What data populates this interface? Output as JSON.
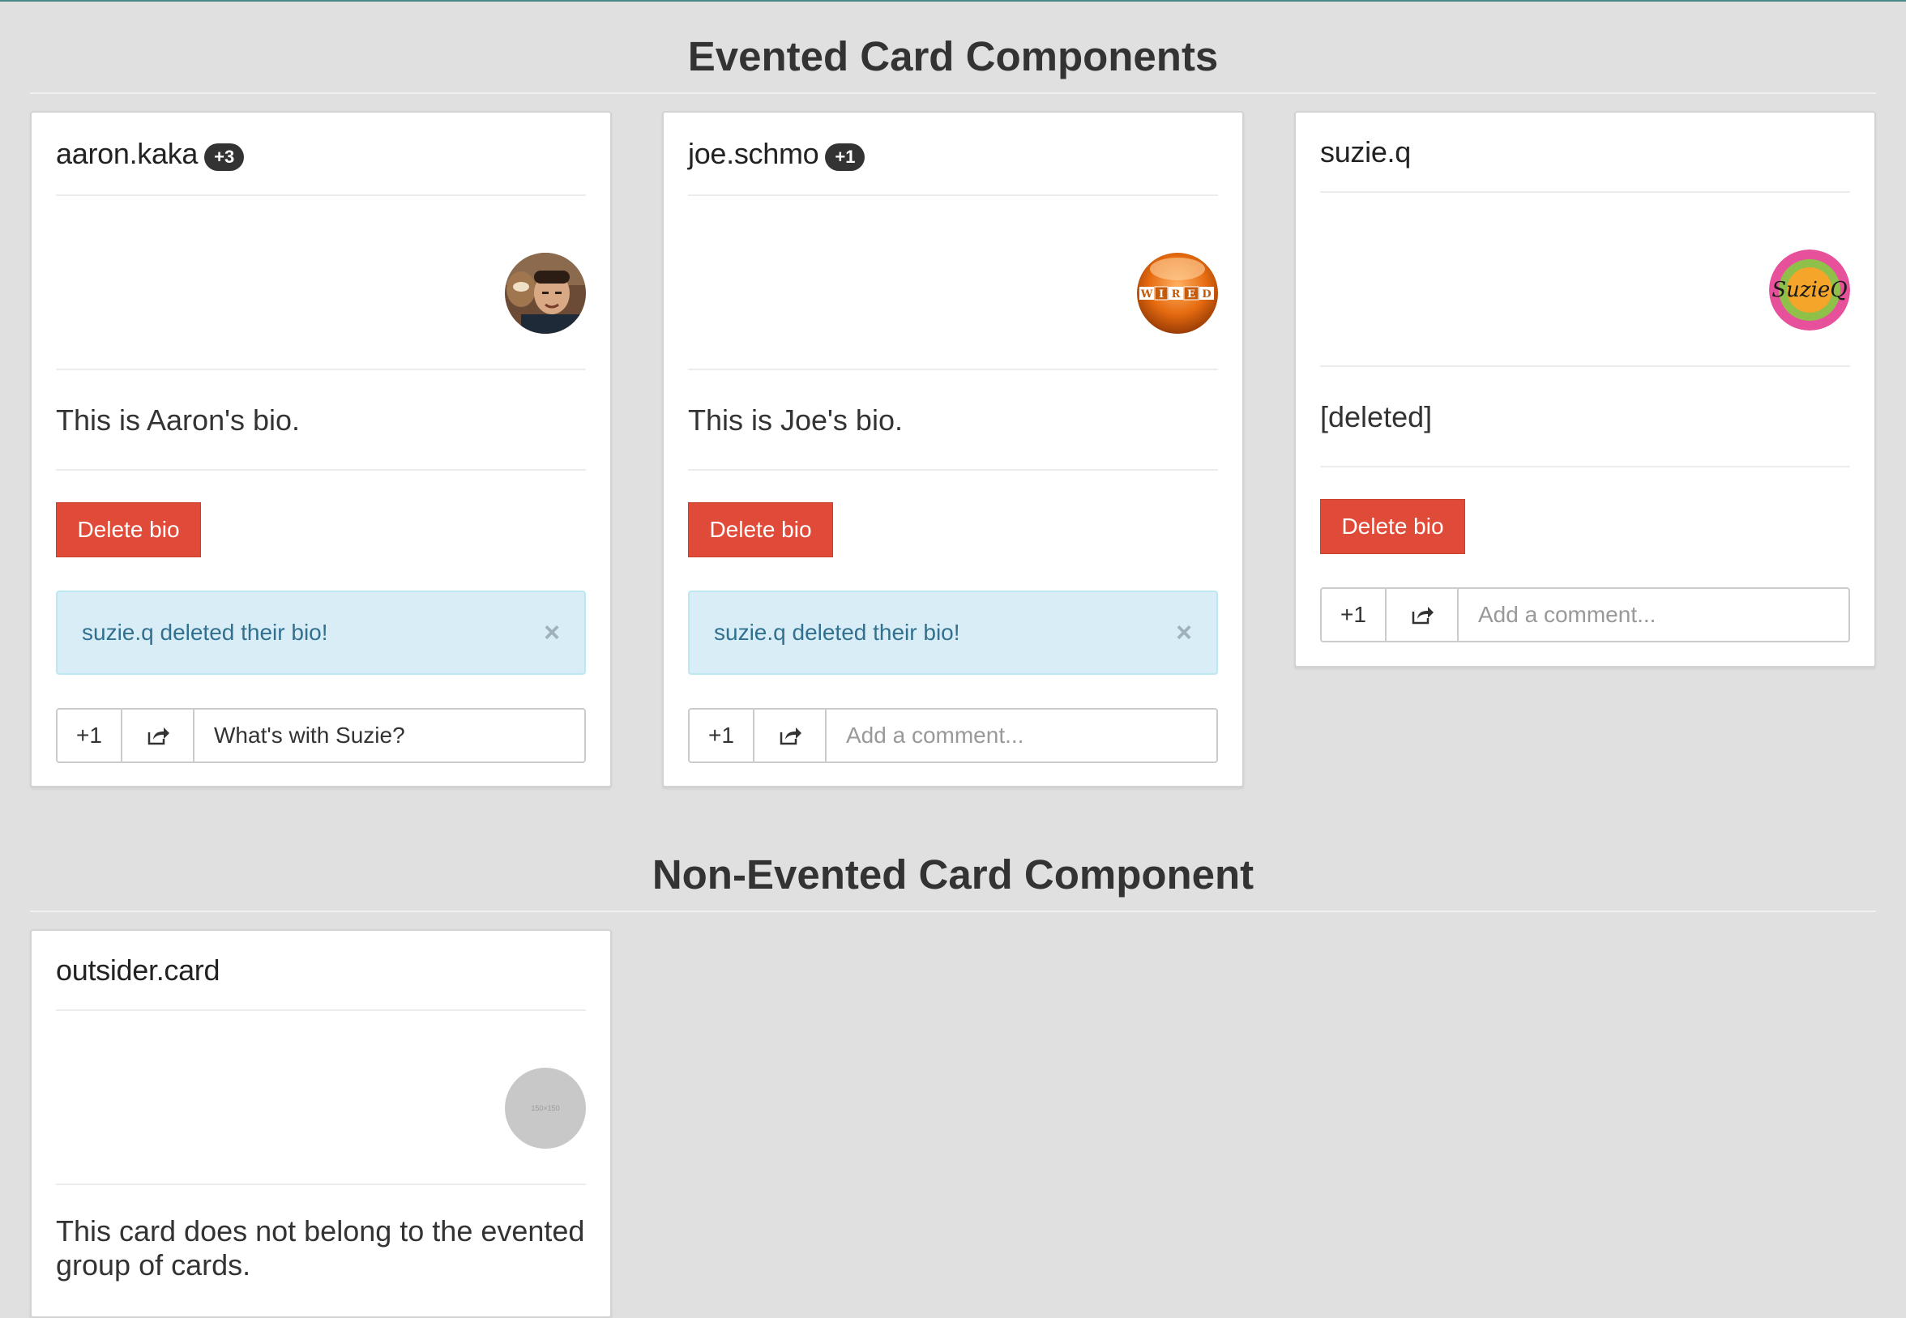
{
  "sections": {
    "evented_title": "Evented Card Components",
    "non_evented_title": "Non-Evented Card Component"
  },
  "cards": [
    {
      "username": "aaron.kaka",
      "badge": "+3",
      "bio": "This is Aaron's bio.",
      "delete_label": "Delete bio",
      "alert_text": "suzie.q deleted their bio!",
      "plus_one_label": "+1",
      "comment_value": "What's with Suzie?",
      "comment_placeholder": "Add a comment..."
    },
    {
      "username": "joe.schmo",
      "badge": "+1",
      "bio": "This is Joe's bio.",
      "delete_label": "Delete bio",
      "alert_text": "suzie.q deleted their bio!",
      "plus_one_label": "+1",
      "comment_value": "",
      "comment_placeholder": "Add a comment...",
      "avatar_text": "WIRED"
    },
    {
      "username": "suzie.q",
      "bio": "[deleted]",
      "delete_label": "Delete bio",
      "plus_one_label": "+1",
      "comment_value": "",
      "comment_placeholder": "Add a comment...",
      "avatar_text": "SuzieQ"
    }
  ],
  "outsider": {
    "username": "outsider.card",
    "bio": "This card does not belong to the evented group of cards.",
    "avatar_text": "150×150"
  },
  "colors": {
    "danger": "#e04b39",
    "info_bg": "#d9edf7",
    "info_text": "#31708f",
    "page_bg": "#e0e0e0"
  },
  "icons": {
    "share": "share-icon",
    "close": "close-icon"
  }
}
